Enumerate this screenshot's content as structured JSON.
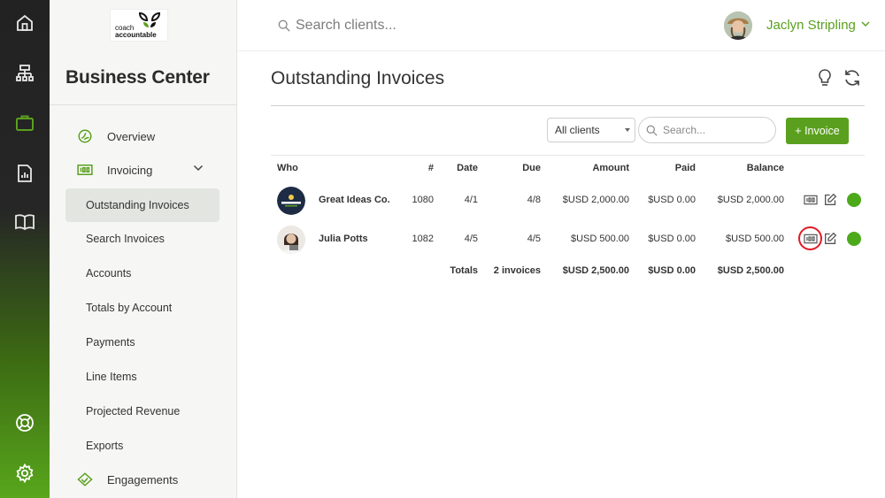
{
  "sidebar": {
    "logo_line1": "coach",
    "logo_line2": "accountable",
    "title": "Business Center",
    "main_items": [
      {
        "label": "Overview"
      },
      {
        "label": "Invoicing"
      },
      {
        "label": "Engagements"
      }
    ],
    "sub_items": [
      {
        "label": "Outstanding Invoices",
        "active": true
      },
      {
        "label": "Search Invoices"
      },
      {
        "label": "Accounts"
      },
      {
        "label": "Totals by Account"
      },
      {
        "label": "Payments"
      },
      {
        "label": "Line Items"
      },
      {
        "label": "Projected Revenue"
      },
      {
        "label": "Exports"
      }
    ]
  },
  "rail": {
    "icons": [
      "home-icon",
      "org-chart-icon",
      "briefcase-icon",
      "report-icon",
      "book-icon",
      "help-icon",
      "settings-icon"
    ],
    "active": "briefcase-icon"
  },
  "topbar": {
    "search_placeholder": "Search clients...",
    "user_name": "Jaclyn Stripling"
  },
  "main": {
    "title": "Outstanding Invoices",
    "filter_selected": "All clients",
    "search_placeholder": "Search...",
    "add_button": "+ Invoice",
    "columns": {
      "who": "Who",
      "num": "#",
      "date": "Date",
      "due": "Due",
      "amount": "Amount",
      "paid": "Paid",
      "balance": "Balance"
    },
    "rows": [
      {
        "who": "Great Ideas Co.",
        "num": "1080",
        "date": "4/1",
        "due": "4/8",
        "amount": "$USD 2,000.00",
        "paid": "$USD 0.00",
        "balance": "$USD 2,000.00"
      },
      {
        "who": "Julia Potts",
        "num": "1082",
        "date": "4/5",
        "due": "4/5",
        "amount": "$USD 500.00",
        "paid": "$USD 0.00",
        "balance": "$USD 500.00"
      }
    ],
    "totals": {
      "label": "Totals",
      "count": "2 invoices",
      "amount": "$USD 2,500.00",
      "paid": "$USD 0.00",
      "balance": "$USD 2,500.00"
    }
  },
  "colors": {
    "accent": "#5aa01e",
    "status": "#4caa1a",
    "highlight": "#e01b24"
  }
}
